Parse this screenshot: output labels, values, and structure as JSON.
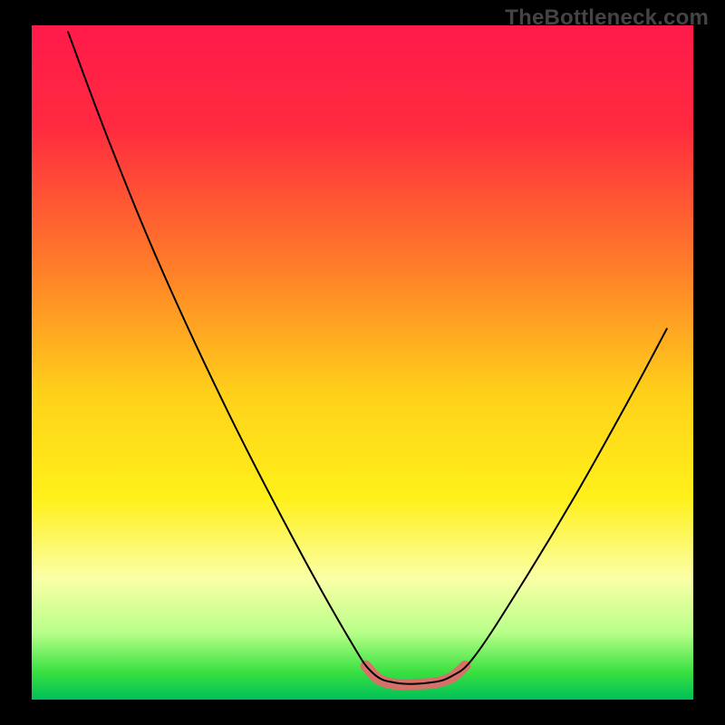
{
  "watermark": "TheBottleneck.com",
  "chart_data": {
    "type": "line",
    "title": "",
    "xlabel": "",
    "ylabel": "",
    "xlim": [
      0,
      100
    ],
    "ylim": [
      0,
      100
    ],
    "gradient_stops": [
      {
        "offset": 0,
        "color": "#ff1a4b"
      },
      {
        "offset": 15,
        "color": "#ff2a3f"
      },
      {
        "offset": 35,
        "color": "#ff7a2a"
      },
      {
        "offset": 55,
        "color": "#ffd21a"
      },
      {
        "offset": 70,
        "color": "#fff01a"
      },
      {
        "offset": 82,
        "color": "#fbffa6"
      },
      {
        "offset": 90,
        "color": "#b9ff8a"
      },
      {
        "offset": 96,
        "color": "#38e040"
      },
      {
        "offset": 100,
        "color": "#00c05a"
      }
    ],
    "series": [
      {
        "name": "bottleneck-curve",
        "stroke": "#000000",
        "stroke_width": 2,
        "points": [
          {
            "x": 5.5,
            "y": 99.0
          },
          {
            "x": 12.0,
            "y": 82.0
          },
          {
            "x": 20.0,
            "y": 63.0
          },
          {
            "x": 30.0,
            "y": 42.0
          },
          {
            "x": 40.0,
            "y": 23.0
          },
          {
            "x": 48.0,
            "y": 9.0
          },
          {
            "x": 51.5,
            "y": 4.0
          },
          {
            "x": 55.0,
            "y": 2.5
          },
          {
            "x": 60.0,
            "y": 2.5
          },
          {
            "x": 63.5,
            "y": 3.5
          },
          {
            "x": 67.0,
            "y": 6.5
          },
          {
            "x": 74.0,
            "y": 17.0
          },
          {
            "x": 82.0,
            "y": 30.0
          },
          {
            "x": 90.0,
            "y": 44.0
          },
          {
            "x": 96.0,
            "y": 55.0
          }
        ]
      },
      {
        "name": "optimal-zone-highlight",
        "stroke": "#e06a6a",
        "stroke_width": 12,
        "points": [
          {
            "x": 50.5,
            "y": 5.0
          },
          {
            "x": 52.5,
            "y": 3.0
          },
          {
            "x": 55.0,
            "y": 2.3
          },
          {
            "x": 58.0,
            "y": 2.3
          },
          {
            "x": 61.0,
            "y": 2.5
          },
          {
            "x": 63.5,
            "y": 3.3
          },
          {
            "x": 65.5,
            "y": 5.0
          }
        ]
      }
    ]
  }
}
